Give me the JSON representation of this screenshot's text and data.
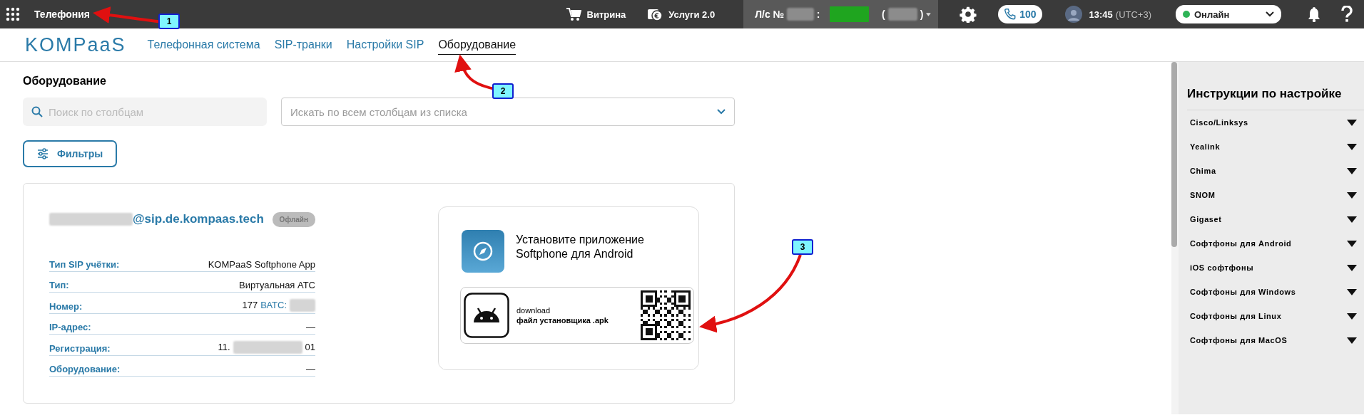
{
  "topbar": {
    "section_title": "Телефония",
    "links": [
      {
        "kind": "cart",
        "label": "Витрина"
      },
      {
        "kind": "services",
        "label": "Услуги 2.0"
      }
    ],
    "account": {
      "prefix": "Л/с №",
      "separator": ":",
      "open": "(",
      "close": ")",
      "redacted": true
    },
    "calls": "100",
    "time": "13:45",
    "timezone": "(UTC+3)",
    "status": {
      "label": "Онлайн",
      "color": "#2fb457"
    }
  },
  "nav": {
    "logo": "KOMPaaS",
    "tabs": [
      {
        "label": "Телефонная система",
        "selected": false
      },
      {
        "label": "SIP-транки",
        "selected": false
      },
      {
        "label": "Настройки SIP",
        "selected": false
      },
      {
        "label": "Оборудование",
        "selected": true
      }
    ]
  },
  "page_title": "Оборудование",
  "search": {
    "placeholder": "Поиск по столбцам"
  },
  "column_select": {
    "placeholder": "Искать по всем столбцам из списка"
  },
  "filters_button": "Фильтры",
  "device": {
    "address": "@sip.de.kompaas.tech",
    "address_redacted": true,
    "status": "Офлайн",
    "rows": [
      {
        "label": "Тип SIP учётки:",
        "value": "KOMPaaS Softphone App"
      },
      {
        "label": "Тип:",
        "value": "Виртуальная АТС"
      },
      {
        "label": "Номер:",
        "value": "177",
        "link": "ВАТС:",
        "redacted": true
      },
      {
        "label": "IP-адрес:",
        "value": "—"
      },
      {
        "label": "Регистрация:",
        "value": "11.",
        "redacted": true,
        "tail": "01"
      },
      {
        "label": "Оборудование:",
        "value": "—"
      }
    ]
  },
  "app_promo": {
    "title": "Установите приложение Softphone для Android",
    "caption": "download",
    "file": "файл установщика .apk"
  },
  "sidebar": {
    "title": "Инструкции по настройке",
    "items": [
      {
        "label": "Cisco/Linksys",
        "expanded": false
      },
      {
        "label": "Yealink",
        "expanded": false
      },
      {
        "label": "Chima",
        "expanded": false
      },
      {
        "label": "SNOM",
        "expanded": false
      },
      {
        "label": "Gigaset",
        "expanded": false
      },
      {
        "label": "Софтфоны для Android",
        "expanded": false
      },
      {
        "label": "iOS софтфоны",
        "expanded": false
      },
      {
        "label": "Софтфоны для Windows",
        "expanded": false
      },
      {
        "label": "Софтфоны для Linux",
        "expanded": false
      },
      {
        "label": "Софтфоны для MacOS",
        "expanded": false
      }
    ]
  },
  "annotations": [
    {
      "label": "1"
    },
    {
      "label": "2"
    },
    {
      "label": "3"
    }
  ]
}
